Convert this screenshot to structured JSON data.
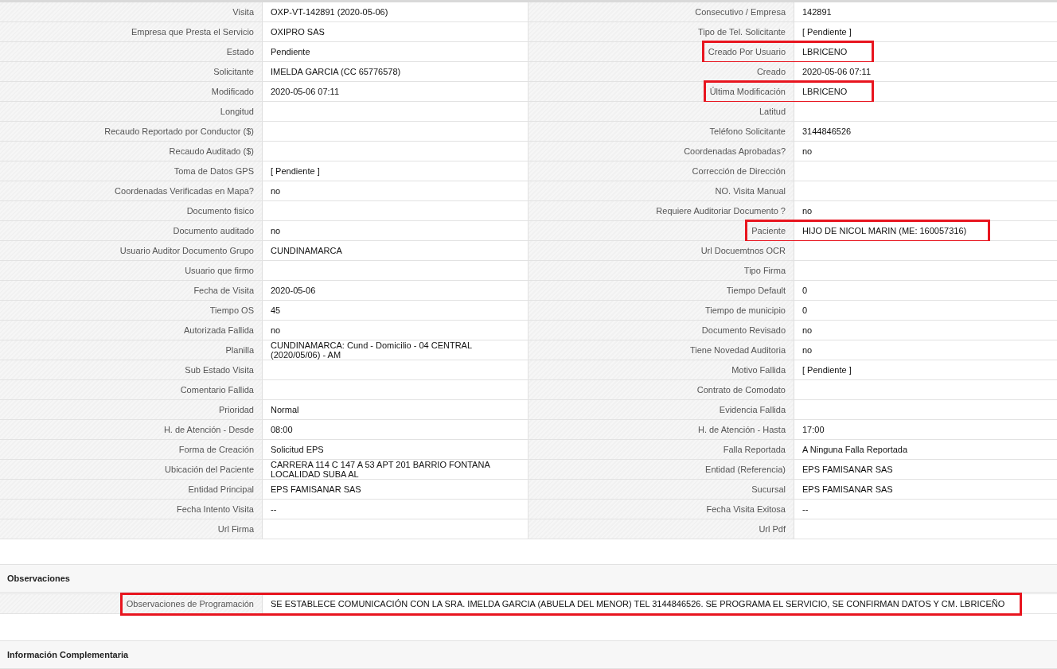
{
  "details": [
    {
      "left": {
        "label": "Visita",
        "value": "OXP-VT-142891 (2020-05-06)"
      },
      "right": {
        "label": "Consecutivo / Empresa",
        "value": "142891"
      }
    },
    {
      "left": {
        "label": "Empresa que Presta el Servicio",
        "value": "OXIPRO SAS"
      },
      "right": {
        "label": "Tipo de Tel. Solicitante",
        "value": "[ Pendiente ]"
      }
    },
    {
      "left": {
        "label": "Estado",
        "value": "Pendiente"
      },
      "right": {
        "label": "Creado Por Usuario",
        "value": "LBRICENO",
        "highlighted": true
      }
    },
    {
      "left": {
        "label": "Solicitante",
        "value": "IMELDA GARCIA (CC 65776578)"
      },
      "right": {
        "label": "Creado",
        "value": "2020-05-06 07:11"
      }
    },
    {
      "left": {
        "label": "Modificado",
        "value": "2020-05-06 07:11"
      },
      "right": {
        "label": "Última Modificación",
        "value": "LBRICENO",
        "highlighted": true
      }
    },
    {
      "left": {
        "label": "Longitud"
      },
      "right": {
        "label": "Latitud"
      }
    },
    {
      "left": {
        "label": "Recaudo Reportado por Conductor ($)"
      },
      "right": {
        "label": "Teléfono Solicitante",
        "value": "3144846526"
      }
    },
    {
      "left": {
        "label": "Recaudo Auditado ($)"
      },
      "right": {
        "label": "Coordenadas Aprobadas?",
        "value": "no"
      }
    },
    {
      "left": {
        "label": "Toma de Datos GPS",
        "value": "[ Pendiente ]"
      },
      "right": {
        "label": "Corrección de Dirección"
      }
    },
    {
      "left": {
        "label": "Coordenadas Verificadas en Mapa?",
        "value": "no"
      },
      "right": {
        "label": "NO. Visita Manual"
      }
    },
    {
      "left": {
        "label": "Documento fisico"
      },
      "right": {
        "label": "Requiere Auditoriar Documento ?",
        "value": "no"
      }
    },
    {
      "left": {
        "label": "Documento auditado",
        "value": "no"
      },
      "right": {
        "label": "Paciente",
        "value": "HIJO DE NICOL MARIN (ME: 160057316)",
        "highlighted": true
      }
    },
    {
      "left": {
        "label": "Usuario Auditor Documento Grupo",
        "value": "CUNDINAMARCA"
      },
      "right": {
        "label": "Url Docuemtnos OCR"
      }
    },
    {
      "left": {
        "label": "Usuario que firmo"
      },
      "right": {
        "label": "Tipo Firma"
      }
    },
    {
      "left": {
        "label": "Fecha de Visita",
        "value": "2020-05-06"
      },
      "right": {
        "label": "Tiempo Default",
        "value": "0"
      }
    },
    {
      "left": {
        "label": "Tiempo OS",
        "value": "45"
      },
      "right": {
        "label": "Tiempo de municipio",
        "value": "0"
      }
    },
    {
      "left": {
        "label": "Autorizada Fallida",
        "value": "no"
      },
      "right": {
        "label": "Documento Revisado",
        "value": "no"
      }
    },
    {
      "left": {
        "label": "Planilla",
        "value": "CUNDINAMARCA: Cund - Domicilio - 04 CENTRAL (2020/05/06) - AM"
      },
      "right": {
        "label": "Tiene Novedad Auditoria",
        "value": "no"
      }
    },
    {
      "left": {
        "label": "Sub Estado Visita"
      },
      "right": {
        "label": "Motivo Fallida",
        "value": "[ Pendiente ]"
      }
    },
    {
      "left": {
        "label": "Comentario Fallida"
      },
      "right": {
        "label": "Contrato de Comodato"
      }
    },
    {
      "left": {
        "label": "Prioridad",
        "value": "Normal"
      },
      "right": {
        "label": "Evidencia Fallida"
      }
    },
    {
      "left": {
        "label": "H. de Atención - Desde",
        "value": "08:00"
      },
      "right": {
        "label": "H. de Atención - Hasta",
        "value": "17:00"
      }
    },
    {
      "left": {
        "label": "Forma de Creación",
        "value": "Solicitud EPS"
      },
      "right": {
        "label": "Falla Reportada",
        "value": "A Ninguna Falla Reportada"
      }
    },
    {
      "left": {
        "label": "Ubicación del Paciente",
        "value": "CARRERA 114 C 147 A 53 APT 201 BARRIO FONTANA LOCALIDAD SUBA AL"
      },
      "right": {
        "label": "Entidad (Referencia)",
        "value": "EPS FAMISANAR SAS"
      }
    },
    {
      "left": {
        "label": "Entidad Principal",
        "value": "EPS FAMISANAR SAS"
      },
      "right": {
        "label": "Sucursal",
        "value": "EPS FAMISANAR SAS"
      }
    },
    {
      "left": {
        "label": "Fecha Intento Visita",
        "value": "--"
      },
      "right": {
        "label": "Fecha Visita Exitosa",
        "value": "--"
      }
    },
    {
      "left": {
        "label": "Url Firma"
      },
      "right": {
        "label": "Url Pdf"
      }
    }
  ],
  "observaciones": {
    "title": "Observaciones",
    "field": {
      "label": "Observaciones de Programación",
      "value": "SE ESTABLECE COMUNICACIÓN CON LA SRA. IMELDA GARCIA (ABUELA DEL MENOR) TEL 3144846526. SE PROGRAMA EL SERVICIO, SE CONFIRMAN DATOS Y CM. LBRICEÑO",
      "highlighted": true
    }
  },
  "informacion_complementaria": {
    "title": "Información Complementaria"
  }
}
